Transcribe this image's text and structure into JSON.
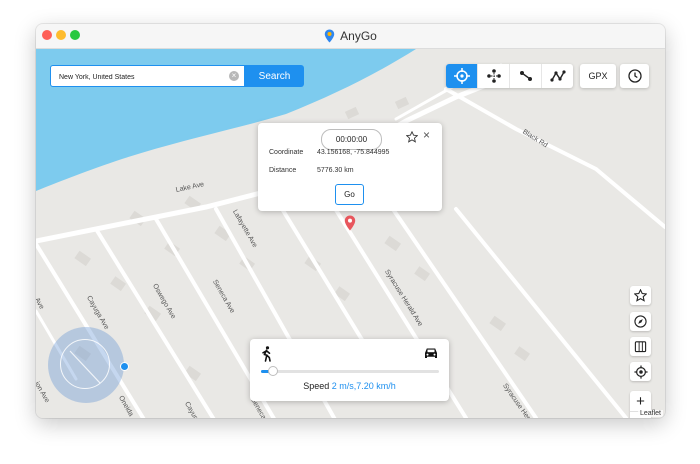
{
  "window": {
    "title": "AnyGo"
  },
  "search": {
    "value": "New York, United States",
    "button": "Search"
  },
  "toolbar": {
    "modes": [
      {
        "name": "teleport-mode-button",
        "icon": "crosshair-icon",
        "active": true
      },
      {
        "name": "jump-teleport-button",
        "icon": "multi-point-icon",
        "active": false
      },
      {
        "name": "two-spot-button",
        "icon": "two-spot-route-icon",
        "active": false
      },
      {
        "name": "multi-spot-button",
        "icon": "multi-spot-route-icon",
        "active": false
      }
    ],
    "gpx": "GPX",
    "history_icon": "clock-icon"
  },
  "popup": {
    "timer": "00:00:00",
    "coordinate_label": "Coordinate",
    "coordinate_value": "43.156168, -75.844995",
    "distance_label": "Distance",
    "distance_value": "5776.30 km",
    "go": "Go"
  },
  "map": {
    "streets": [
      "Black Rd",
      "Lake Ave",
      "Lafayette Ave",
      "Seneca Ave",
      "Oswego Ave",
      "Cayuga Ave",
      "Syracuse Herald Ave",
      "Syracuse Herald Ave",
      "Seneca Ave",
      "Cayuga Ave",
      "Oneida",
      "ion Ave",
      "Ave"
    ],
    "attribution": "Leaflet",
    "water_color": "#7dcbee",
    "land_color": "#e9e8e5"
  },
  "side_tools": [
    "star-icon",
    "compass-icon",
    "map-layers-icon",
    "locate-icon"
  ],
  "zoom": {
    "in": "+",
    "out": "−"
  },
  "speed": {
    "label": "Speed",
    "value": "2 m/s,7.20 km/h",
    "level": 0.04,
    "walk_icon": "walking-icon",
    "car_icon": "car-icon"
  },
  "accent": "#1e90ef"
}
